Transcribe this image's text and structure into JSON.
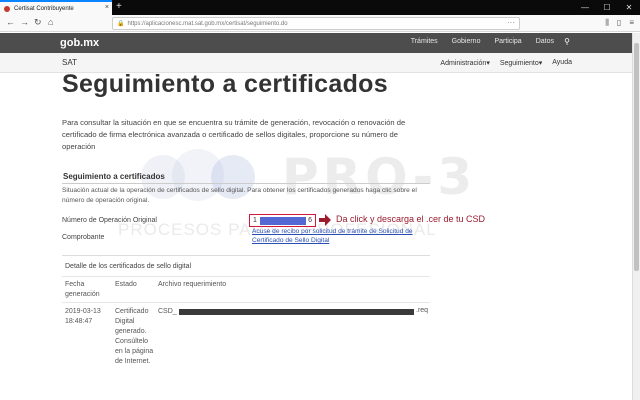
{
  "browser": {
    "tab_title": "Certisat Contribuyente",
    "tab_close": "×",
    "new_tab": "+",
    "url": "https://aplicacionesc.mat.sat.gob.mx/certisat/seguimiento.do",
    "url_menu": "···",
    "window_controls": [
      "—",
      "☐",
      "✕"
    ],
    "nav_back": "←",
    "nav_forward": "→",
    "nav_reload": "↻",
    "nav_home": "⌂"
  },
  "gob_header": {
    "logo": "gob.mx",
    "links": [
      "Trámites",
      "Gobierno",
      "Participa",
      "Datos"
    ],
    "search_icon": "⚲"
  },
  "sat_header": {
    "title": "SAT",
    "menu": [
      "Administración▾",
      "Seguimiento▾",
      "Ayuda"
    ]
  },
  "main": {
    "title": "Seguimiento a certificados",
    "intro": "Para consultar la situación en que se encuentra su trámite de generación, revocación o renovación de certificado de firma electrónica avanzada o certificado de sellos digitales, proporcione su número de operación",
    "section_title": "Seguimiento a certificados",
    "section_desc": "Situación actual de la operación de certificados de sello digital. Para obtener los certificados generados haga clic sobre el número de operación original.",
    "op_label": "Número de Operación Original",
    "op_value_first": "1",
    "op_value_last": "6",
    "comprobante_label": "Comprobante",
    "acuse_link": "Acuse de recibo por solicitud de trámite de Solicitud de Certificado de Sello Digital",
    "annotation": "Da click y descarga el .cer de tu CSD"
  },
  "detail": {
    "title": "Detalle de los certificados de sello digital",
    "headers": [
      "Fecha generación",
      "Estado",
      "Archivo requerimiento"
    ],
    "row": {
      "fecha": "2019-03-13 18:48:47",
      "estado": "Certificado Digital generado. Consúltelo en la página de Internet.",
      "archivo_prefix": "CSD_",
      "archivo_ext": ".req"
    }
  },
  "watermark": {
    "text": "PRO-3",
    "subtext": "PROCESOS PARA ... PROFESIONAL"
  },
  "colors": {
    "gob_bar": "#4d4d4d",
    "annotation": "#9b1c2e",
    "link": "#2a4fb3",
    "highlight_border": "#d2193c"
  }
}
